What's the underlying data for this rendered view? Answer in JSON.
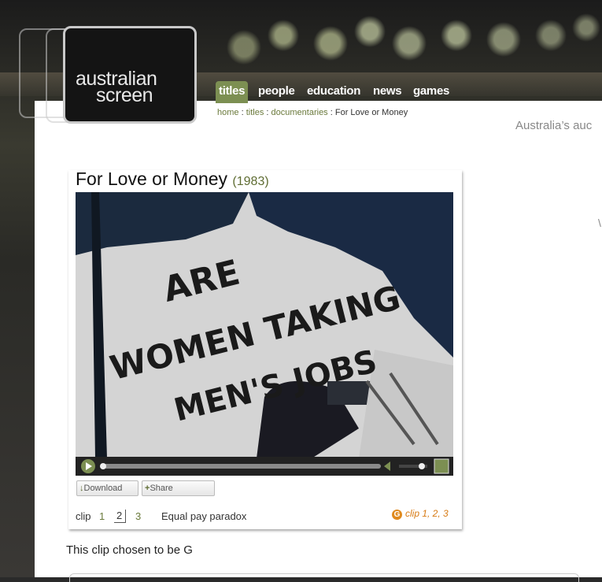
{
  "logo": {
    "line1": "australian",
    "line2": "screen"
  },
  "nav": {
    "items": [
      {
        "label": "titles",
        "active": true
      },
      {
        "label": "people",
        "active": false
      },
      {
        "label": "education",
        "active": false
      },
      {
        "label": "news",
        "active": false
      },
      {
        "label": "games",
        "active": false
      }
    ],
    "active_color": "#7c8f52"
  },
  "breadcrumb": {
    "home": "home",
    "titles": "titles",
    "documentaries": "documentaries",
    "separator": ":",
    "current": "For Love or Money"
  },
  "tagline": "Australia’s auc",
  "stray_char": "\\",
  "clip": {
    "title": "For Love or Money",
    "year": "(1983)",
    "video_sign": {
      "line1": "ARE",
      "line2": "WOMEN TAKING",
      "line3": "MEN'S JOBS"
    },
    "download_label": "Download",
    "share_label": "Share",
    "clip_label": "clip",
    "clip_numbers": [
      "1",
      "2",
      "3"
    ],
    "current_clip": "2",
    "clip_title": "Equal pay paradox",
    "classification_badge": "G",
    "clip_range_label": "clip 1, 2, 3"
  },
  "chosen_text": "This clip chosen to be G",
  "colors": {
    "link": "#6b7a3c",
    "accent_orange": "#d77a13"
  }
}
